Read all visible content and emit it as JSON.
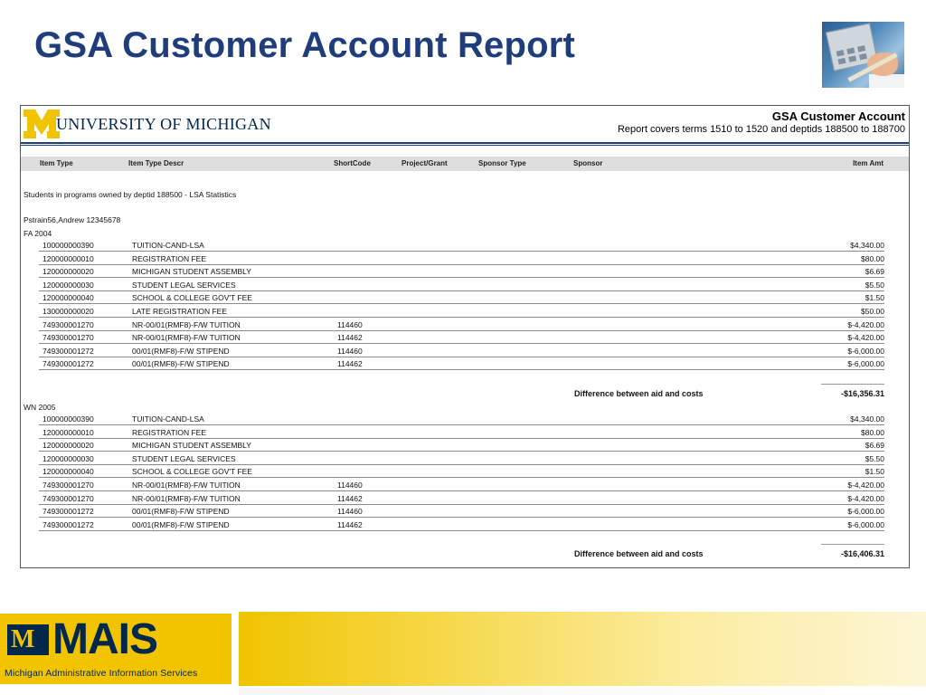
{
  "slide": {
    "title": "GSA Customer Account Report"
  },
  "report": {
    "university": "UNIVERSITY OF MICHIGAN",
    "title": "GSA Customer Account",
    "subtitle": "Report covers terms 1510 to 1520 and deptids 188500 to 188700",
    "columns": [
      "Item Type",
      "Item Type Descr",
      "ShortCode",
      "Project/Grant",
      "Sponsor Type",
      "Sponsor",
      "Item Amt"
    ],
    "section_heading": "Students in programs owned by deptid 188500 - LSA Statistics",
    "student": "Pstrain56,Andrew  12345678",
    "terms": [
      {
        "name": "FA 2004",
        "rows": [
          {
            "item": "100000000390",
            "descr": "TUITION-CAND-LSA",
            "short": "",
            "amt": "$4,340.00"
          },
          {
            "item": "120000000010",
            "descr": "REGISTRATION FEE",
            "short": "",
            "amt": "$80.00"
          },
          {
            "item": "120000000020",
            "descr": "MICHIGAN STUDENT ASSEMBLY",
            "short": "",
            "amt": "$6.69"
          },
          {
            "item": "120000000030",
            "descr": "STUDENT LEGAL SERVICES",
            "short": "",
            "amt": "$5.50"
          },
          {
            "item": "120000000040",
            "descr": "SCHOOL & COLLEGE GOV'T FEE",
            "short": "",
            "amt": "$1.50"
          },
          {
            "item": "130000000020",
            "descr": "LATE REGISTRATION FEE",
            "short": "",
            "amt": "$50.00"
          },
          {
            "item": "749300001270",
            "descr": "NR-00/01(RMF8)-F/W TUITION",
            "short": "114460",
            "amt": "$-4,420.00"
          },
          {
            "item": "749300001270",
            "descr": "NR-00/01(RMF8)-F/W TUITION",
            "short": "114462",
            "amt": "$-4,420.00"
          },
          {
            "item": "749300001272",
            "descr": "00/01(RMF8)-F/W STIPEND",
            "short": "114460",
            "amt": "$-6,000.00"
          },
          {
            "item": "749300001272",
            "descr": "00/01(RMF8)-F/W STIPEND",
            "short": "114462",
            "amt": "$-6,000.00"
          }
        ],
        "diff_label": "Difference between aid and costs",
        "diff_amt": "-$16,356.31"
      },
      {
        "name": "WN 2005",
        "rows": [
          {
            "item": "100000000390",
            "descr": "TUITION-CAND-LSA",
            "short": "",
            "amt": "$4,340.00"
          },
          {
            "item": "120000000010",
            "descr": "REGISTRATION FEE",
            "short": "",
            "amt": "$80.00"
          },
          {
            "item": "120000000020",
            "descr": "MICHIGAN STUDENT ASSEMBLY",
            "short": "",
            "amt": "$6.69"
          },
          {
            "item": "120000000030",
            "descr": "STUDENT LEGAL SERVICES",
            "short": "",
            "amt": "$5.50"
          },
          {
            "item": "120000000040",
            "descr": "SCHOOL & COLLEGE GOV'T FEE",
            "short": "",
            "amt": "$1.50"
          },
          {
            "item": "749300001270",
            "descr": "NR-00/01(RMF8)-F/W TUITION",
            "short": "114460",
            "amt": "$-4,420.00"
          },
          {
            "item": "749300001270",
            "descr": "NR-00/01(RMF8)-F/W TUITION",
            "short": "114462",
            "amt": "$-4,420.00"
          },
          {
            "item": "749300001272",
            "descr": "00/01(RMF8)-F/W STIPEND",
            "short": "114460",
            "amt": "$-6,000.00"
          },
          {
            "item": "749300001272",
            "descr": "00/01(RMF8)-F/W STIPEND",
            "short": "114462",
            "amt": "$-6,000.00"
          }
        ],
        "diff_label": "Difference between aid and costs",
        "diff_amt": "-$16,406.31"
      }
    ]
  },
  "footer": {
    "logo_word": "MAIS",
    "logo_mark": "M",
    "tagline": "Michigan Administrative Information Services"
  },
  "colors": {
    "title": "#1f3d7a",
    "maize": "#f2c400",
    "blue": "#00274c"
  },
  "icons": {
    "photo": "calculator-photo-icon",
    "block_m": "block-m-icon"
  }
}
